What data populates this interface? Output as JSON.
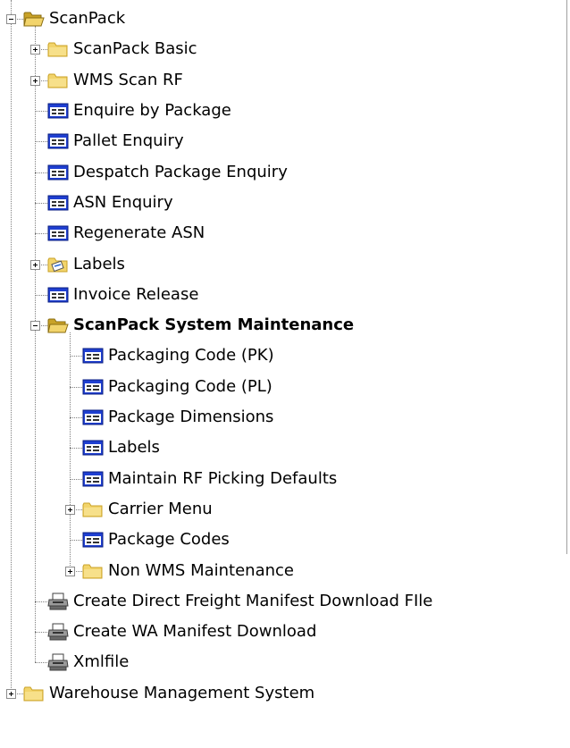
{
  "tree": {
    "items": [
      {
        "label": "ScanPack",
        "icon": "folder-open-icon",
        "expander": "minus",
        "level": 0
      },
      {
        "label": "ScanPack Basic",
        "icon": "folder-icon",
        "expander": "plus",
        "level": 1
      },
      {
        "label": "WMS Scan RF",
        "icon": "folder-icon",
        "expander": "plus",
        "level": 1
      },
      {
        "label": "Enquire by Package",
        "icon": "form-icon",
        "expander": "none",
        "level": 1
      },
      {
        "label": "Pallet Enquiry",
        "icon": "form-icon",
        "expander": "none",
        "level": 1
      },
      {
        "label": "Despatch Package Enquiry",
        "icon": "form-icon",
        "expander": "none",
        "level": 1
      },
      {
        "label": "ASN Enquiry",
        "icon": "form-icon",
        "expander": "none",
        "level": 1
      },
      {
        "label": "Regenerate ASN",
        "icon": "form-icon",
        "expander": "none",
        "level": 1
      },
      {
        "label": "Labels",
        "icon": "folder-labels-icon",
        "expander": "plus",
        "level": 1
      },
      {
        "label": "Invoice Release",
        "icon": "form-icon",
        "expander": "none",
        "level": 1
      },
      {
        "label": "ScanPack System Maintenance",
        "icon": "folder-open-icon",
        "expander": "minus",
        "level": 1,
        "bold": true
      },
      {
        "label": "Packaging Code (PK)",
        "icon": "form-icon",
        "expander": "none",
        "level": 2
      },
      {
        "label": "Packaging Code (PL)",
        "icon": "form-icon",
        "expander": "none",
        "level": 2
      },
      {
        "label": "Package Dimensions",
        "icon": "form-icon",
        "expander": "none",
        "level": 2
      },
      {
        "label": "Labels",
        "icon": "form-icon",
        "expander": "none",
        "level": 2
      },
      {
        "label": "Maintain RF Picking Defaults",
        "icon": "form-icon",
        "expander": "none",
        "level": 2
      },
      {
        "label": "Carrier Menu",
        "icon": "folder-icon",
        "expander": "plus",
        "level": 2
      },
      {
        "label": "Package Codes",
        "icon": "form-icon",
        "expander": "none",
        "level": 2
      },
      {
        "label": "Non WMS Maintenance",
        "icon": "folder-icon",
        "expander": "plus",
        "level": 2
      },
      {
        "label": "Create Direct Freight Manifest Download FIle",
        "icon": "printer-icon",
        "expander": "none",
        "level": 1
      },
      {
        "label": "Create WA Manifest Download",
        "icon": "printer-icon",
        "expander": "none",
        "level": 1
      },
      {
        "label": "Xmlfile",
        "icon": "printer-icon",
        "expander": "none",
        "level": 1
      },
      {
        "label": "Warehouse Management System",
        "icon": "folder-icon",
        "expander": "plus",
        "level": 0
      }
    ]
  },
  "colors": {
    "folder": "#f2d46b",
    "folder_dark": "#c9a227",
    "form_blue": "#1f3fd1",
    "form_bg": "#ffffff",
    "connector": "#808080",
    "printer": "#404040"
  }
}
